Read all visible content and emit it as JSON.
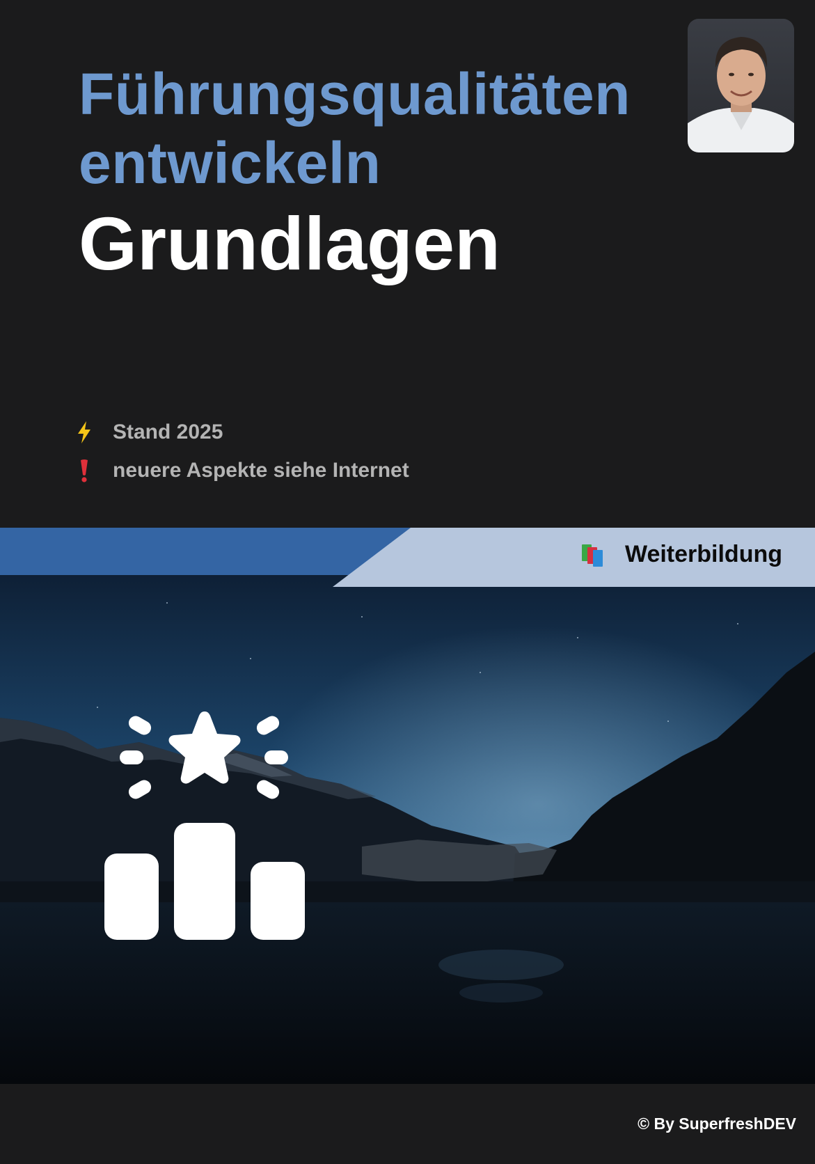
{
  "header": {
    "title_line1": "Führungsqualitäten",
    "title_line2": "entwickeln",
    "subtitle": "Grundlagen"
  },
  "notes": [
    {
      "icon": "lightning-icon",
      "text": "Stand 2025",
      "icon_color": "#f5c518"
    },
    {
      "icon": "exclamation-icon",
      "text": "neuere Aspekte siehe Internet",
      "icon_color": "#e0303a"
    }
  ],
  "banner": {
    "label": "Weiterbildung",
    "icon": "books-icon",
    "left_color": "#3465a4",
    "right_color": "#b6c6dd"
  },
  "hero": {
    "icon": "award-podium-icon"
  },
  "footer": {
    "copyright": "© By SuperfreshDEV"
  },
  "colors": {
    "background": "#1b1b1c",
    "title_accent": "#6e99cf",
    "note_text": "#b4b4b4"
  }
}
